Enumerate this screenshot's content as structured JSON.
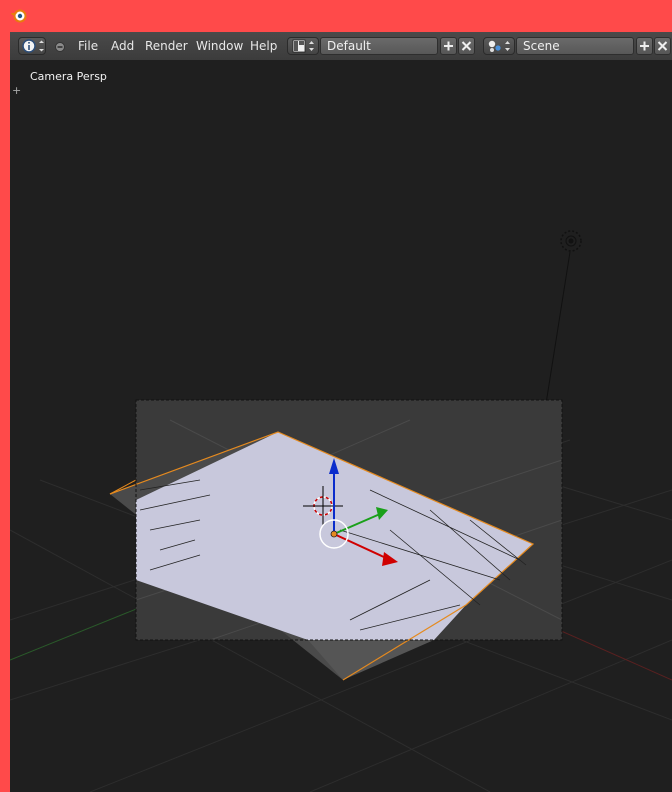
{
  "menu": {
    "items": [
      "File",
      "Add",
      "Render",
      "Window",
      "Help"
    ]
  },
  "screen_layout": {
    "value": "Default"
  },
  "scene": {
    "value": "Scene"
  },
  "viewport": {
    "view_label": "Camera Persp"
  },
  "icons": {
    "app_logo": "blender-logo-icon",
    "info_editor": "info-icon",
    "collapse": "minus-circle-icon",
    "layout": "screen-layout-icon",
    "scene": "scene-icon",
    "add": "plus-icon",
    "delete": "close-icon"
  },
  "colors": {
    "titlebar": "#ff4a4a",
    "viewport_bg": "#1f1f1f",
    "plane": "#c8c8dc",
    "selection_outline": "#e58a1f",
    "axis_x": "#d00000",
    "axis_y": "#1aa01a",
    "axis_z": "#0a2ccc"
  }
}
